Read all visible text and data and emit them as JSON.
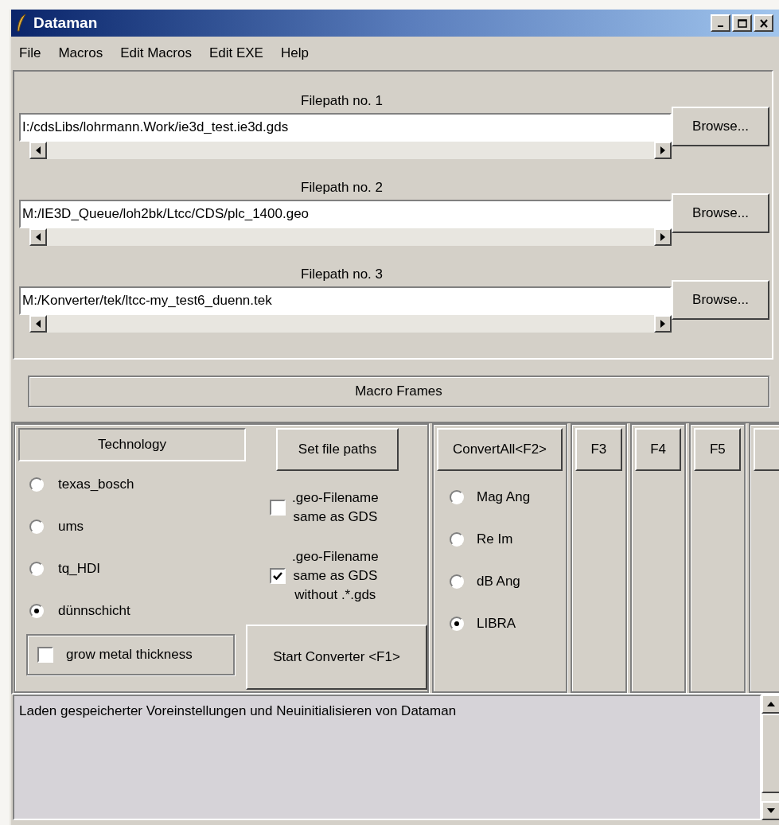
{
  "window": {
    "title": "Dataman"
  },
  "menu": [
    "File",
    "Macros",
    "Edit Macros",
    "Edit EXE",
    "Help"
  ],
  "filepaths": [
    {
      "label": "Filepath no. 1",
      "value": "I:/cdsLibs/lohrmann.Work/ie3d_test.ie3d.gds",
      "button": "Browse..."
    },
    {
      "label": "Filepath no. 2",
      "value": "M:/IE3D_Queue/loh2bk/Ltcc/CDS/plc_1400.geo",
      "button": "Browse..."
    },
    {
      "label": "Filepath no. 3",
      "value": "M:/Konverter/tek/ltcc-my_test6_duenn.tek",
      "button": "Browse..."
    }
  ],
  "macro_frames": "Macro Frames",
  "technology": {
    "header": "Technology",
    "options": [
      {
        "label": "texas_bosch",
        "selected": false
      },
      {
        "label": "ums",
        "selected": false
      },
      {
        "label": "tq_HDI",
        "selected": false
      },
      {
        "label": "dünnschicht",
        "selected": true
      }
    ],
    "grow_metal": {
      "label": "grow metal thickness",
      "checked": false
    }
  },
  "set_file_paths": "Set file paths",
  "filename_options": [
    {
      "label": ".geo-Filename\nsame as GDS",
      "checked": false
    },
    {
      "label": ".geo-Filename\nsame as GDS\nwithout .*.gds",
      "checked": true
    }
  ],
  "start_button": "Start Converter <F1>",
  "convert": {
    "button": "ConvertAll<F2>",
    "options": [
      {
        "label": "Mag Ang",
        "selected": false
      },
      {
        "label": "Re Im",
        "selected": false
      },
      {
        "label": "dB Ang",
        "selected": false
      },
      {
        "label": "LIBRA",
        "selected": true
      }
    ]
  },
  "function_buttons": [
    "F3",
    "F4",
    "F5"
  ],
  "log": "Laden gespeicherter Voreinstellungen und Neuinitialisieren von Dataman"
}
